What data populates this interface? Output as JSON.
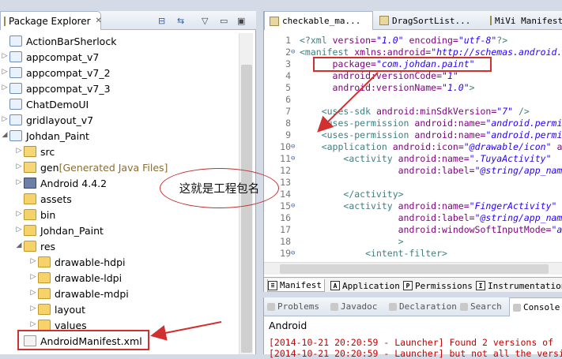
{
  "package_explorer": {
    "title": "Package Explorer",
    "close_glyph": "✕",
    "tree": [
      {
        "label": "ActionBarSherlock",
        "icon": "project-icon",
        "expanded": null
      },
      {
        "label": "appcompat_v7",
        "icon": "project-icon",
        "expanded": false
      },
      {
        "label": "appcompat_v7_2",
        "icon": "project-icon",
        "expanded": false
      },
      {
        "label": "appcompat_v7_3",
        "icon": "project-icon",
        "expanded": false
      },
      {
        "label": "ChatDemoUI",
        "icon": "project-icon",
        "expanded": null
      },
      {
        "label": "gridlayout_v7",
        "icon": "project-icon",
        "expanded": false
      },
      {
        "label": "Johdan_Paint",
        "icon": "project-icon",
        "expanded": true
      },
      {
        "label": "src",
        "icon": "source-folder-icon",
        "expanded": false
      },
      {
        "label": "gen",
        "suffix": "[Generated Java Files]",
        "icon": "source-folder-icon",
        "expanded": false
      },
      {
        "label": "Android 4.4.2",
        "icon": "library-icon",
        "expanded": false
      },
      {
        "label": "assets",
        "icon": "folder-icon",
        "expanded": null
      },
      {
        "label": "bin",
        "icon": "folder-icon",
        "expanded": false
      },
      {
        "label": "Johdan_Paint",
        "icon": "folder-icon",
        "expanded": false
      },
      {
        "label": "res",
        "icon": "folder-icon",
        "expanded": true
      },
      {
        "label": "drawable-hdpi",
        "icon": "folder-icon",
        "expanded": false
      },
      {
        "label": "drawable-ldpi",
        "icon": "folder-icon",
        "expanded": false
      },
      {
        "label": "drawable-mdpi",
        "icon": "folder-icon",
        "expanded": false
      },
      {
        "label": "layout",
        "icon": "folder-icon",
        "expanded": false
      },
      {
        "label": "values",
        "icon": "folder-icon",
        "expanded": false
      },
      {
        "label": "AndroidManifest.xml",
        "icon": "xml-file-icon",
        "expanded": null
      }
    ]
  },
  "editor": {
    "tabs": [
      "checkable_ma...",
      "DragSortList...",
      "MiVi Manifest"
    ],
    "lines": [
      {
        "n": "1",
        "fold": "",
        "html": "<span class='tag'>&lt;?xml</span> <span class='attr'>version=</span><span class='val'>\"1.0\"</span> <span class='attr'>encoding=</span><span class='val'>\"utf-8\"</span><span class='tag'>?&gt;</span>"
      },
      {
        "n": "2",
        "fold": "⊖",
        "html": "<span class='tag'>&lt;manifest</span> <span class='attr'>xmlns:android=</span><span class='val'>\"http://schemas.android.</span>"
      },
      {
        "n": "3",
        "fold": "",
        "html": "      <span class='attr'>package=</span><span class='val'>\"com.johdan.paint\"</span>"
      },
      {
        "n": "4",
        "fold": "",
        "html": "      <span class='attr'>android:versionCode=</span><span class='val'>\"1\"</span>"
      },
      {
        "n": "5",
        "fold": "",
        "html": "      <span class='attr'>android:versionName=</span><span class='val'>\"1.0\"</span><span class='tag'>&gt;</span>"
      },
      {
        "n": "6",
        "fold": "",
        "html": ""
      },
      {
        "n": "7",
        "fold": "",
        "html": "    <span class='tag'>&lt;uses-sdk</span> <span class='attr'>android:minSdkVersion=</span><span class='val'>\"7\"</span> <span class='tag'>/&gt;</span>"
      },
      {
        "n": "8",
        "fold": "",
        "html": "    <span class='tag'>&lt;uses-permission</span> <span class='attr'>android:name=</span><span class='val'>\"android.permi</span>"
      },
      {
        "n": "9",
        "fold": "",
        "html": "    <span class='tag'>&lt;uses-permission</span> <span class='attr'>android:name=</span><span class='val'>\"android.permi</span>"
      },
      {
        "n": "10",
        "fold": "⊖",
        "html": "    <span class='tag'>&lt;application</span> <span class='attr'>android:icon=</span><span class='val'>\"@drawable/icon\"</span> <span class='attr'>a</span>"
      },
      {
        "n": "11",
        "fold": "⊖",
        "html": "        <span class='tag'>&lt;activity</span> <span class='attr'>android:name=</span><span class='val'>\".TuyaActivity\"</span>"
      },
      {
        "n": "12",
        "fold": "",
        "html": "                  <span class='attr'>android:label=</span><span class='val'>\"@string/app_nam</span>"
      },
      {
        "n": "13",
        "fold": "",
        "html": ""
      },
      {
        "n": "14",
        "fold": "",
        "html": "        <span class='tag'>&lt;/activity&gt;</span>"
      },
      {
        "n": "15",
        "fold": "⊖",
        "html": "        <span class='tag'>&lt;activity</span> <span class='attr'>android:name=</span><span class='val'>\"FingerActivity\"</span>"
      },
      {
        "n": "16",
        "fold": "",
        "html": "                  <span class='attr'>android:label=</span><span class='val'>\"@string/app_nam</span>"
      },
      {
        "n": "17",
        "fold": "",
        "html": "                  <span class='attr'>android:windowSoftInputMode=</span><span class='val'>\"a</span>"
      },
      {
        "n": "18",
        "fold": "",
        "html": "                  <span class='tag'>&gt;</span>"
      },
      {
        "n": "19",
        "fold": "⊖",
        "html": "            <span class='tag'>&lt;intent-filter&gt;</span>"
      }
    ],
    "manifest_tabs": [
      "Manifest",
      "Application",
      "Permissions",
      "Instrumentation"
    ],
    "manifest_tab_letters": [
      "",
      "A",
      "P",
      "I"
    ]
  },
  "console": {
    "tabs": [
      "Problems",
      "Javadoc",
      "Declaration",
      "Search",
      "Console"
    ],
    "name": "Android",
    "lines": [
      "[2014-10-21 20:20:59 - Launcher] Found 2 versions of",
      "[2014-10-21 20:20:59 - Launcher] but not all the versi"
    ]
  },
  "annotation": {
    "callout_text": "这就是工程包名",
    "color": "#d03030"
  }
}
